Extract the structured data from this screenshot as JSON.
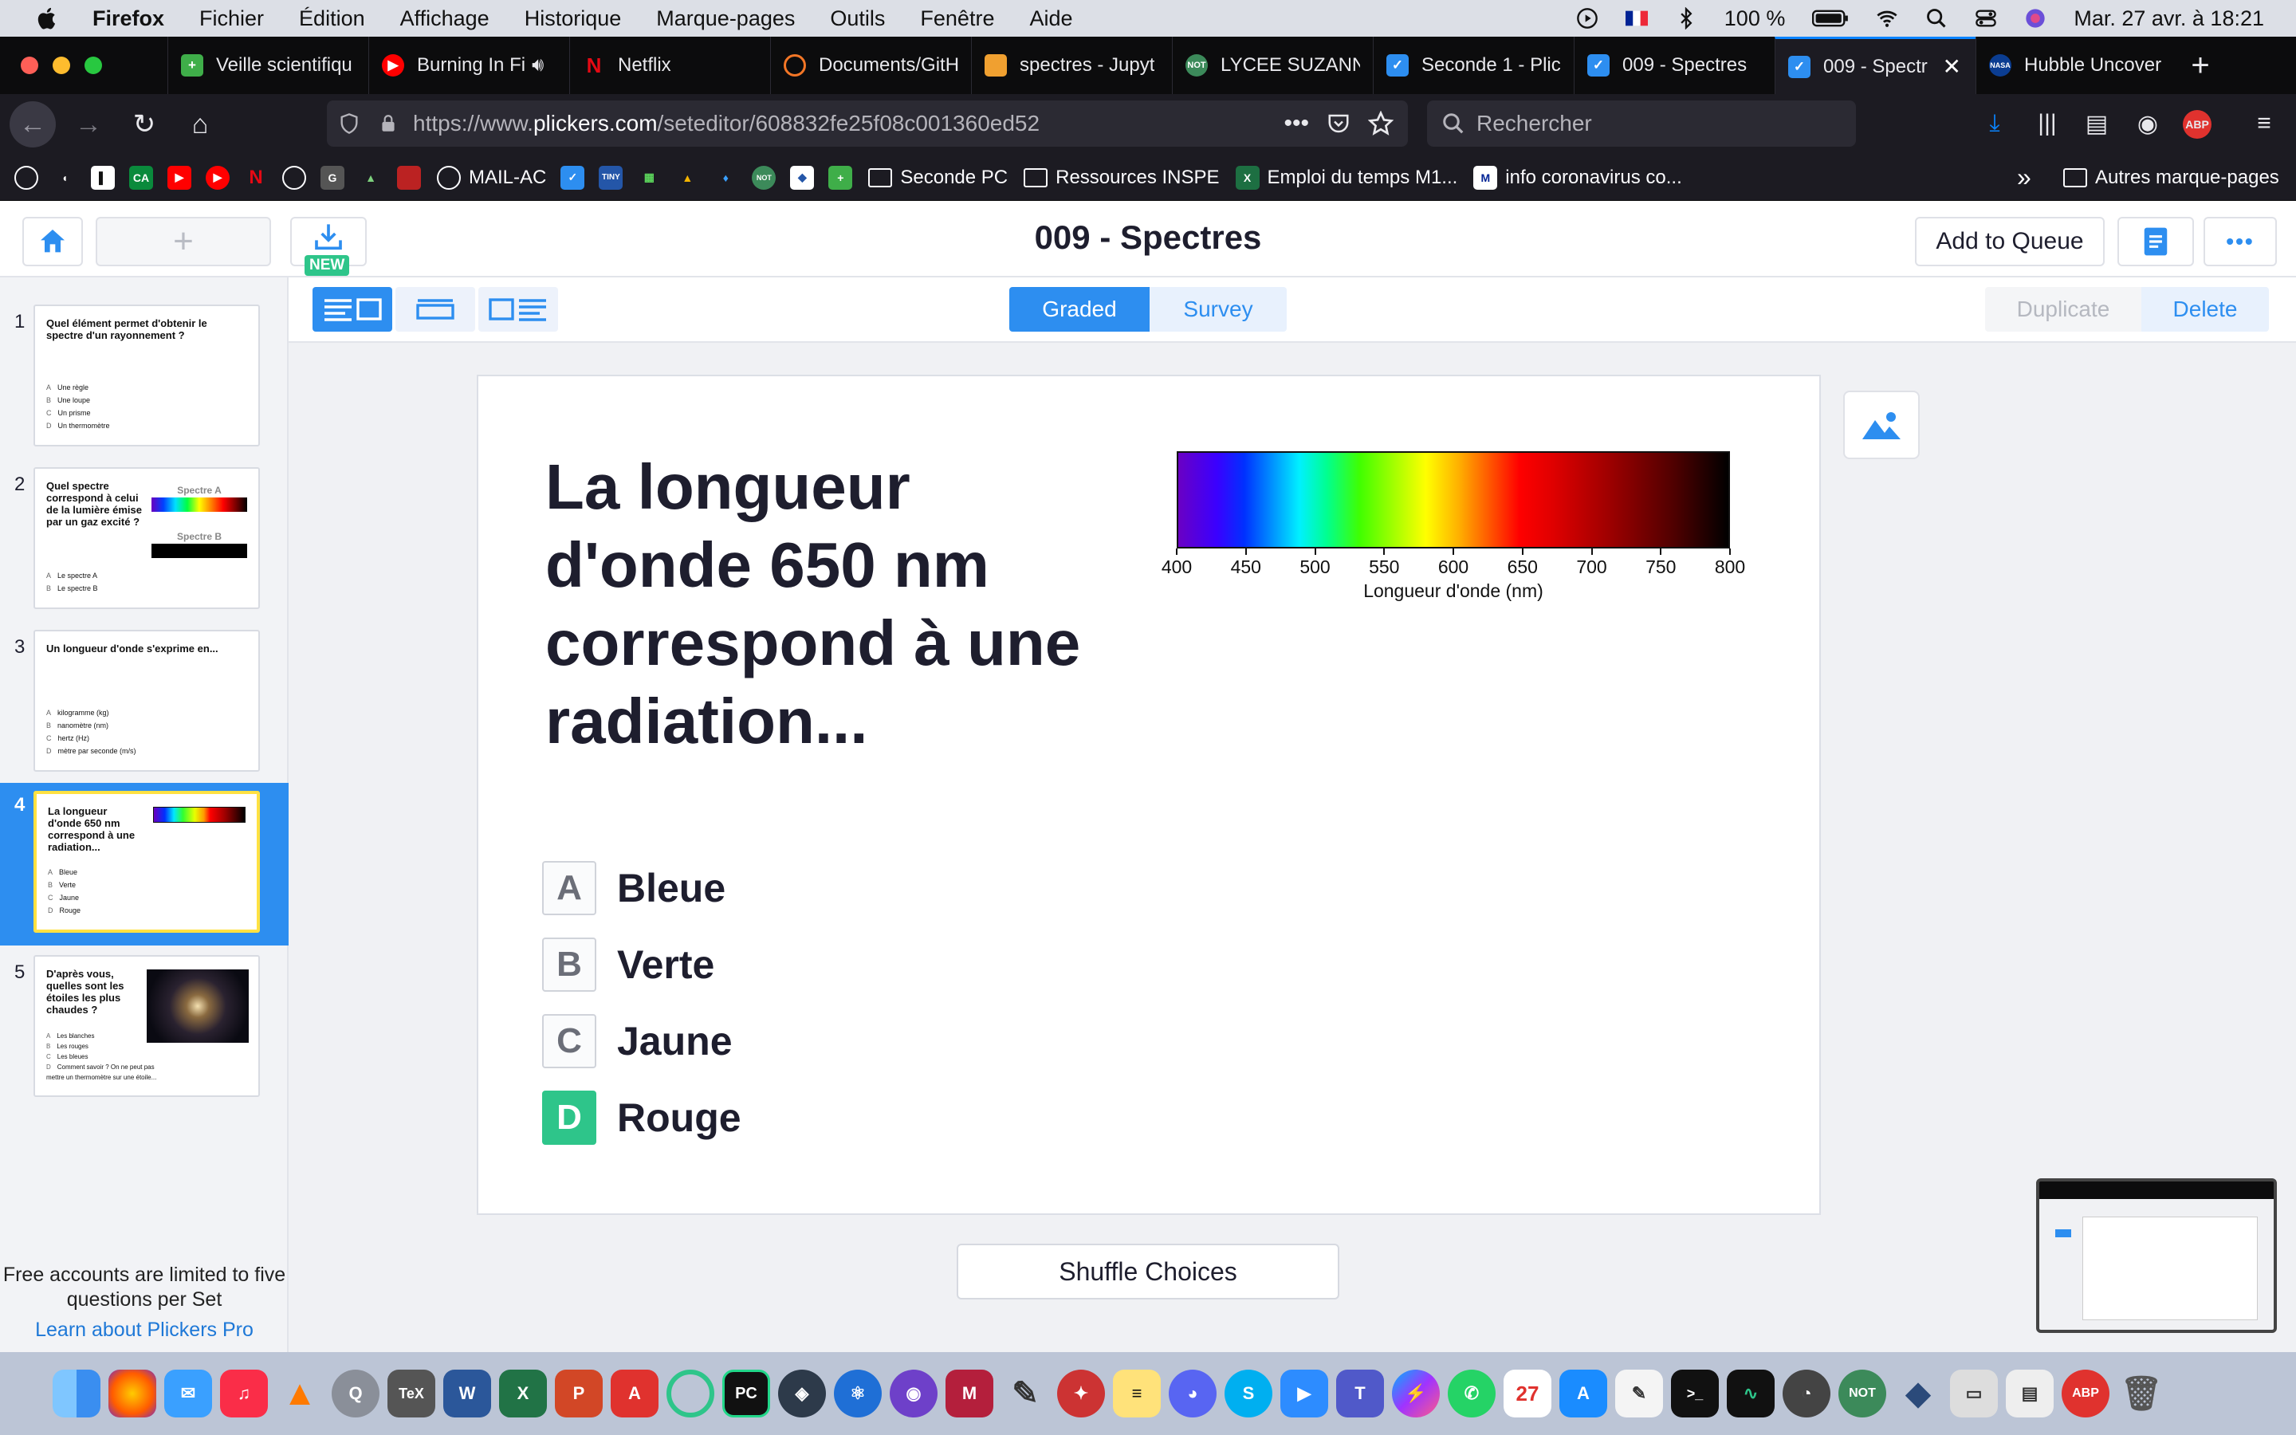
{
  "menubar": {
    "app": "Firefox",
    "items": [
      "Fichier",
      "Édition",
      "Affichage",
      "Historique",
      "Marque-pages",
      "Outils",
      "Fenêtre",
      "Aide"
    ],
    "battery": "100 %",
    "clock": "Mar. 27 avr. à  18:21"
  },
  "tabs": [
    {
      "label": "Veille scientifiqu",
      "icon": "green-plus-icon",
      "color": "#3fae49"
    },
    {
      "label": "Burning In Fi",
      "icon": "youtube-music-icon",
      "color": "#ff0000"
    },
    {
      "label": "Netflix",
      "icon": "netflix-icon",
      "color": "#e50914"
    },
    {
      "label": "Documents/GitH",
      "icon": "jupyter-icon",
      "color": "#f37626"
    },
    {
      "label": "spectres - Jupyt",
      "icon": "notebook-icon",
      "color": "#f0a030"
    },
    {
      "label": "LYCEE SUZANN",
      "icon": "not-icon",
      "color": "#3c8a5a"
    },
    {
      "label": "Seconde 1 - Plic",
      "icon": "plickers-check-icon",
      "color": "#2d8ef0"
    },
    {
      "label": "009 - Spectres",
      "icon": "plickers-check-icon",
      "color": "#2d8ef0"
    },
    {
      "label": "009 - Spectr",
      "icon": "plickers-check-icon",
      "color": "#2d8ef0"
    },
    {
      "label": "Hubble Uncover",
      "icon": "nasa-icon",
      "color": "#0b3d91"
    }
  ],
  "url": {
    "prefix": "https://www.",
    "host": "plickers.com",
    "path": "/seteditor/608832fe25f08c001360ed52"
  },
  "search": {
    "placeholder": "Rechercher"
  },
  "bookmarks": [
    "MAIL-AC",
    "Seconde PC",
    "Ressources INSPE",
    "Emploi du temps M1...",
    "info coronavirus co...",
    "Autres marque-pages"
  ],
  "header": {
    "title": "009 - Spectres",
    "add_to_queue": "Add to Queue",
    "new_badge": "NEW"
  },
  "toolbar": {
    "graded": "Graded",
    "survey": "Survey",
    "duplicate": "Duplicate",
    "delete": "Delete"
  },
  "sidebar": {
    "slides": [
      {
        "num": "1",
        "question": "Quel élément permet d'obtenir le spectre d'un rayonnement ?",
        "choices": [
          "Une règle",
          "Une loupe",
          "Un prisme",
          "Un thermomètre"
        ]
      },
      {
        "num": "2",
        "question": "Quel spectre correspond à celui de la lumière émise par un gaz excité ?",
        "choices": [
          "Le spectre A",
          "Le spectre B"
        ],
        "label_a": "Spectre A",
        "label_b": "Spectre B"
      },
      {
        "num": "3",
        "question": "Un longueur d'onde s'exprime en...",
        "choices": [
          "kilogramme (kg)",
          "nanomètre (nm)",
          "hertz (Hz)",
          "mètre par seconde (m/s)"
        ]
      },
      {
        "num": "4",
        "question": "La longueur d'onde 650 nm correspond à une radiation...",
        "choices": [
          "Bleue",
          "Verte",
          "Jaune",
          "Rouge"
        ]
      },
      {
        "num": "5",
        "question": "D'après vous, quelles sont les étoiles les plus chaudes ?",
        "choices": [
          "Les blanches",
          "Les rouges",
          "Les bleues",
          "Comment savoir ? On ne peut pas mettre un thermomètre sur une étoile..."
        ]
      }
    ],
    "free_note": "Free accounts are limited to five questions per Set",
    "learn_pro": "Learn about Plickers Pro"
  },
  "question": {
    "text": "La longueur d'onde 650 nm correspond à une radiation...",
    "choices": [
      {
        "letter": "A",
        "text": "Bleue",
        "correct": false
      },
      {
        "letter": "B",
        "text": "Verte",
        "correct": false
      },
      {
        "letter": "C",
        "text": "Jaune",
        "correct": false
      },
      {
        "letter": "D",
        "text": "Rouge",
        "correct": true
      }
    ],
    "spectrum": {
      "ticks": [
        "400",
        "450",
        "500",
        "550",
        "600",
        "650",
        "700",
        "750",
        "800"
      ],
      "xlabel": "Longueur d'onde (nm)",
      "range": [
        400,
        800
      ]
    }
  },
  "shuffle": "Shuffle Choices",
  "colors": {
    "accent": "#2d8ef0",
    "correct": "#2ec58a",
    "active_outline": "#ffe142"
  }
}
